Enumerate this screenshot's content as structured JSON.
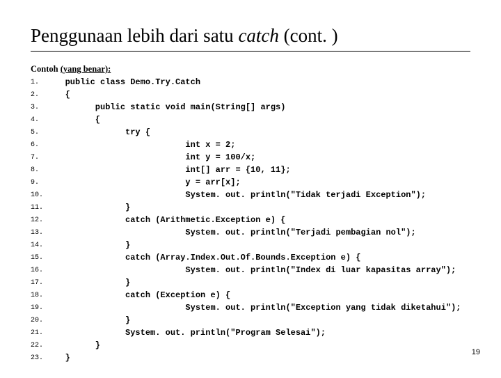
{
  "title_main": "Penggunaan lebih dari satu ",
  "title_ital": "catch",
  "title_tail": " (cont. )",
  "subhead_a": "Contoh ",
  "subhead_b": "(yang benar):",
  "lines": [
    {
      "n": "1.",
      "indent": 0,
      "text": "public class Demo.Try.Catch"
    },
    {
      "n": "2.",
      "indent": 0,
      "text": "{"
    },
    {
      "n": "3.",
      "indent": 1,
      "text": "public static void main(String[] args)"
    },
    {
      "n": "4.",
      "indent": 1,
      "text": "{"
    },
    {
      "n": "5.",
      "indent": 2,
      "text": "try {"
    },
    {
      "n": "6.",
      "indent": 4,
      "text": "int x = 2;"
    },
    {
      "n": "7.",
      "indent": 4,
      "text": "int y = 100/x;"
    },
    {
      "n": "8.",
      "indent": 4,
      "text": "int[] arr = {10, 11};"
    },
    {
      "n": "9.",
      "indent": 4,
      "text": "y = arr[x];"
    },
    {
      "n": "10.",
      "indent": 4,
      "text": "System. out. println(\"Tidak terjadi Exception\");"
    },
    {
      "n": "11.",
      "indent": 2,
      "text": "}"
    },
    {
      "n": "12.",
      "indent": 2,
      "text": "catch (Arithmetic.Exception e) {"
    },
    {
      "n": "13.",
      "indent": 4,
      "text": "System. out. println(\"Terjadi pembagian nol\");"
    },
    {
      "n": "14.",
      "indent": 2,
      "text": "}"
    },
    {
      "n": "15.",
      "indent": 2,
      "text": "catch (Array.Index.Out.Of.Bounds.Exception e) {"
    },
    {
      "n": "16.",
      "indent": 4,
      "text": "System. out. println(\"Index di luar kapasitas array\");"
    },
    {
      "n": "17.",
      "indent": 2,
      "text": "}"
    },
    {
      "n": "18.",
      "indent": 2,
      "text": "catch (Exception e) {"
    },
    {
      "n": "19.",
      "indent": 4,
      "text": "System. out. println(\"Exception yang tidak diketahui\");"
    },
    {
      "n": "20.",
      "indent": 2,
      "text": "}"
    },
    {
      "n": "21.",
      "indent": 2,
      "text": "System. out. println(\"Program Selesai\");"
    },
    {
      "n": "22.",
      "indent": 1,
      "text": "}"
    },
    {
      "n": "23.",
      "indent": 0,
      "text": "}"
    }
  ],
  "indent_unit": "      ",
  "base_indent": "   ",
  "page_number": "19"
}
